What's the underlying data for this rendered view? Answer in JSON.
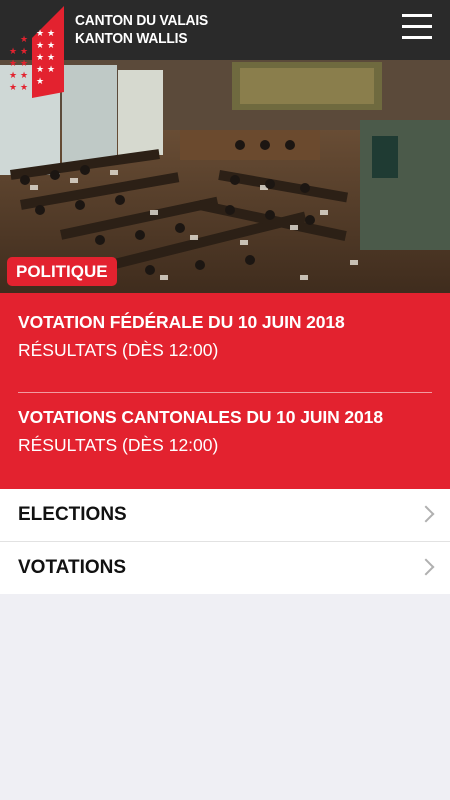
{
  "header": {
    "brand_line1": "CANTON DU VALAIS",
    "brand_line2": "KANTON WALLIS",
    "logo_icon": "valais-flag-icon",
    "menu_icon": "hamburger-menu-icon"
  },
  "hero": {
    "image": "parliament-chamber-photo",
    "category_tag": "POLITIQUE"
  },
  "votes": [
    {
      "title": "VOTATION FÉDÉRALE DU 10 JUIN 2018",
      "subtitle": "RÉSULTATS (DÈS 12:00)"
    },
    {
      "title": "VOTATIONS CANTONALES DU 10 JUIN 2018",
      "subtitle": "RÉSULTATS (DÈS 12:00)"
    }
  ],
  "list": [
    {
      "label": "ELECTIONS",
      "icon": "chevron-right-icon"
    },
    {
      "label": "VOTATIONS",
      "icon": "chevron-right-icon"
    }
  ],
  "colors": {
    "accent": "#e3222f",
    "header_bg": "#2a2a2a",
    "page_bg": "#efeff4"
  }
}
